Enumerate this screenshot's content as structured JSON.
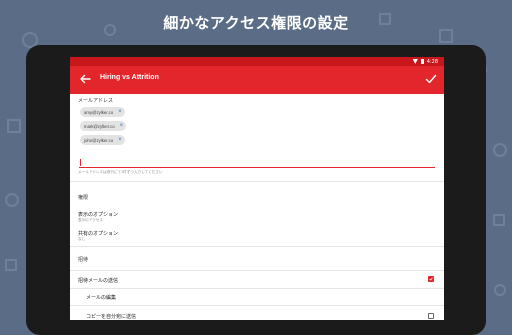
{
  "headline": "細かなアクセス権限の設定",
  "status_bar": {
    "time": "4:28"
  },
  "app_bar": {
    "title": "Hiring vs Attrition"
  },
  "emails": {
    "label": "メールアドレス",
    "chips": [
      "amy@zylker.co",
      "mark@zylker.co",
      "john@zylker.co"
    ],
    "input_value": "",
    "hint": "メールアドレスは改行にて1件ずつ入力してください"
  },
  "permissions": {
    "label": "権限",
    "view": {
      "title": "表示のオプション",
      "value": "表示のアクセス"
    },
    "share": {
      "title": "共有のオプション",
      "value": "なし"
    }
  },
  "invite": {
    "label": "招待",
    "send_invite": {
      "label": "招待メールの送信",
      "checked": true
    },
    "edit_mail": {
      "label": "メールの編集"
    },
    "copy_self": {
      "label": "コピーを自分宛に送信",
      "checked": false
    }
  },
  "colors": {
    "accent": "#e3262c",
    "status_bar": "#c8161d",
    "background": "#5b6d86"
  }
}
